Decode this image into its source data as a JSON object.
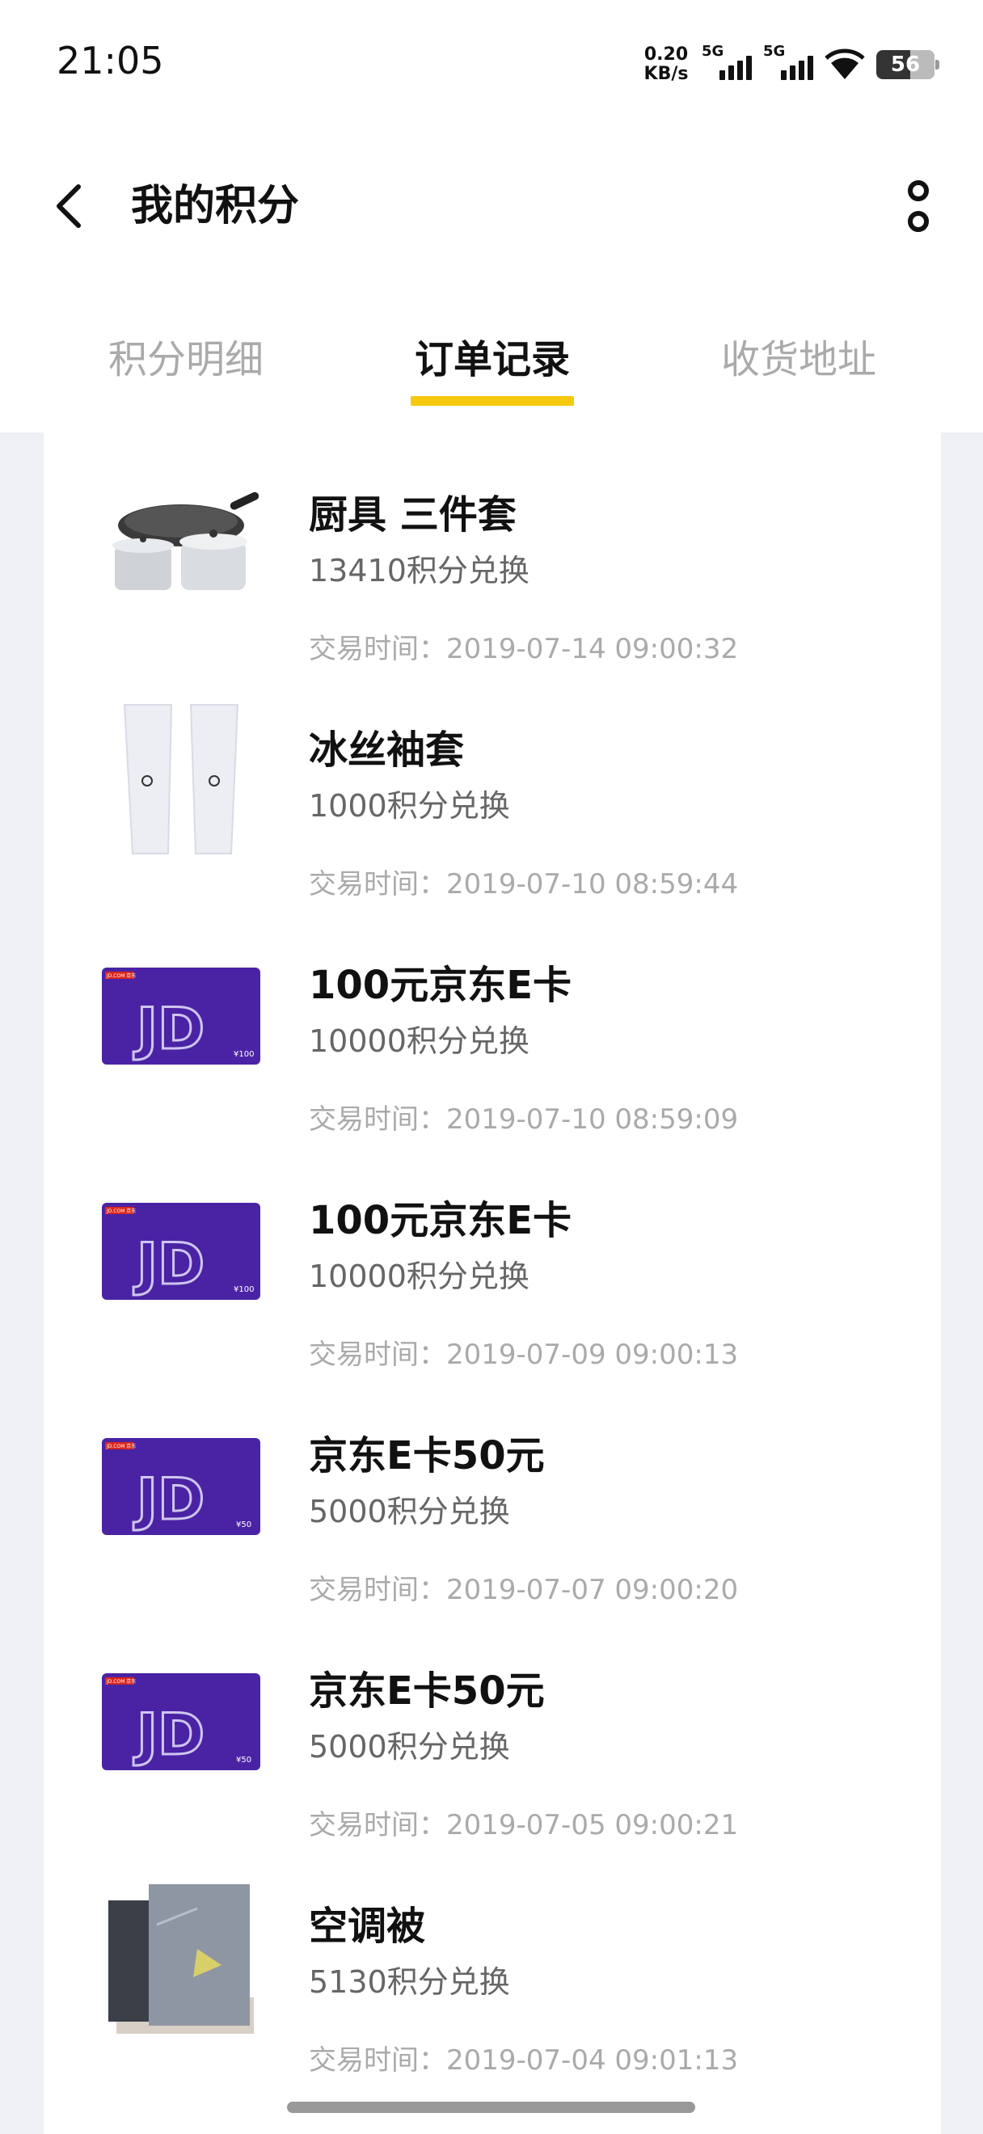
{
  "status_bar": {
    "time": "21:05",
    "net_speed_value": "0.20",
    "net_speed_unit": "KB/s",
    "signal1_label": "5G",
    "signal2_label": "5G",
    "battery": "56"
  },
  "header": {
    "title": "我的积分",
    "back_icon": "chevron-left-icon",
    "more_icon": "more-vertical-icon"
  },
  "tabs": [
    {
      "label": "积分明细",
      "active": false
    },
    {
      "label": "订单记录",
      "active": true
    },
    {
      "label": "收货地址",
      "active": false
    }
  ],
  "accent_color": "#f6c90e",
  "orders": [
    {
      "name": "厨具 三件套",
      "points": "13410积分兑换",
      "time": "交易时间：2019-07-14 09:00:32",
      "image": "cookware-image"
    },
    {
      "name": "冰丝袖套",
      "points": "1000积分兑换",
      "time": "交易时间：2019-07-10 08:59:44",
      "image": "sleeves-image"
    },
    {
      "name": "100元京东E卡",
      "points": "10000积分兑换",
      "time": "交易时间：2019-07-10 08:59:09",
      "image": "jd-card-image",
      "card_value": "¥100"
    },
    {
      "name": "100元京东E卡",
      "points": "10000积分兑换",
      "time": "交易时间：2019-07-09 09:00:13",
      "image": "jd-card-image",
      "card_value": "¥100"
    },
    {
      "name": "京东E卡50元",
      "points": "5000积分兑换",
      "time": "交易时间：2019-07-07 09:00:20",
      "image": "jd-card-image",
      "card_value": "¥50"
    },
    {
      "name": "京东E卡50元",
      "points": "5000积分兑换",
      "time": "交易时间：2019-07-05 09:00:21",
      "image": "jd-card-image",
      "card_value": "¥50"
    },
    {
      "name": "空调被",
      "points": "5130积分兑换",
      "time": "交易时间：2019-07-04 09:01:13",
      "image": "quilt-image"
    }
  ],
  "card_brand": "JD.COM 京东"
}
